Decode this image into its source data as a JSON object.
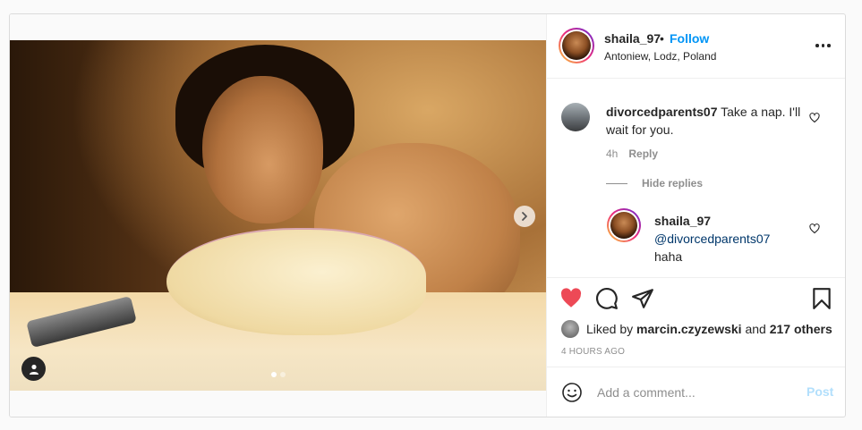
{
  "header": {
    "username": "shaila_97",
    "separator": "•",
    "follow_label": "Follow",
    "location": "Antoniew, Lodz, Poland"
  },
  "comments": [
    {
      "username": "divorcedparents07",
      "text": "Take a nap. I'll wait for you.",
      "age": "4h",
      "reply_label": "Reply",
      "hide_replies_label": "Hide replies",
      "replies": [
        {
          "username": "shaila_97",
          "mention": "@divorcedparents07",
          "text": "haha"
        }
      ]
    }
  ],
  "likes": {
    "prefix": "Liked by",
    "liker": "marcin.czyzewski",
    "joiner": "and",
    "others": "217 others"
  },
  "timestamp": "4 HOURS AGO",
  "add_comment": {
    "placeholder": "Add a comment...",
    "post_label": "Post"
  },
  "carousel": {
    "total": 2,
    "active_index": 0
  },
  "colors": {
    "like_red": "#ed4956",
    "follow_blue": "#0095f6",
    "post_disabled": "#b2dffc"
  }
}
